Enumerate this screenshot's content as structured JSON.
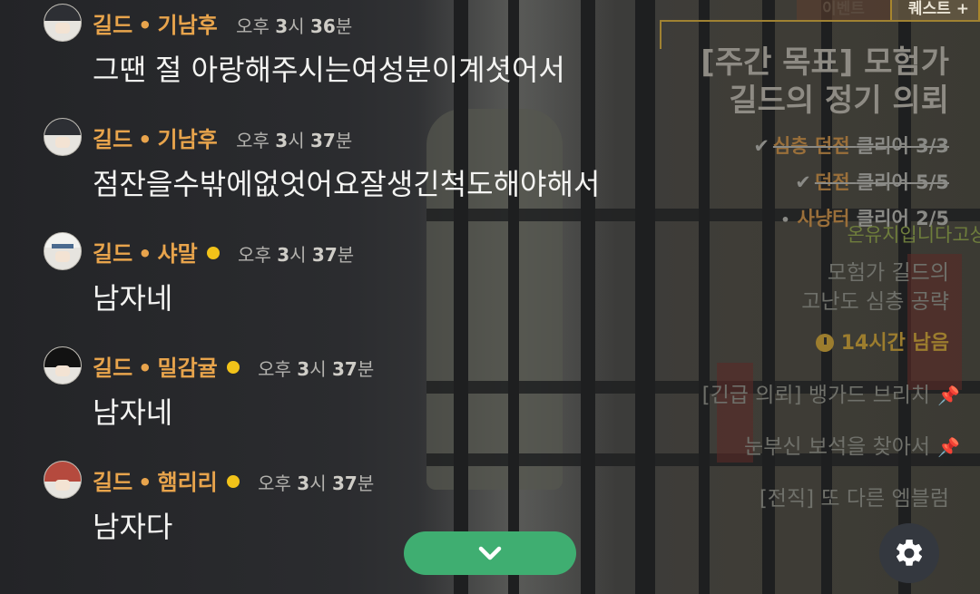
{
  "tabs": [
    {
      "label": "이벤트"
    },
    {
      "label": "퀘스트 +"
    }
  ],
  "quest_panel": {
    "title_line1": "[주간 목표] 모험가",
    "title_line2": "길드의 정기 의뢰",
    "objectives": [
      {
        "check": "✔",
        "name": "심층 던전",
        "text": "클리어 3/3"
      },
      {
        "check": "✔",
        "name": "던전",
        "text": "클리어 5/5"
      },
      {
        "bullet": "•",
        "name": "사냥터",
        "text": "클리어 2/5"
      }
    ],
    "overlap_text": "온유지입니다고상",
    "guild_quest_line1": "모험가 길드의",
    "guild_quest_line2": "고난도 심층 공략",
    "timer": "14시간 남음",
    "quests": [
      {
        "label": "[긴급 의뢰] 뱅가드 브리치"
      },
      {
        "label": "눈부신 보석을 찾아서"
      },
      {
        "label": "[전직] 또 다른 엠블럼"
      }
    ]
  },
  "chat": {
    "messages": [
      {
        "prefix": "길드",
        "separator": "•",
        "user": "기남후",
        "time_prefix": "오후",
        "hour": "3",
        "hour_unit": "시",
        "minute": "36",
        "minute_unit": "분",
        "text": "그땐 절 아랑해주시는여성분이계셧어서"
      },
      {
        "prefix": "길드",
        "separator": "•",
        "user": "기남후",
        "time_prefix": "오후",
        "hour": "3",
        "hour_unit": "시",
        "minute": "37",
        "minute_unit": "분",
        "text": "점잔을수밖에없엇어요잘생긴척도해야해서"
      },
      {
        "prefix": "길드",
        "separator": "•",
        "user": "샤말",
        "time_prefix": "오후",
        "hour": "3",
        "hour_unit": "시",
        "minute": "37",
        "minute_unit": "분",
        "text": "남자네"
      },
      {
        "prefix": "길드",
        "separator": "•",
        "user": "밀감귤",
        "time_prefix": "오후",
        "hour": "3",
        "hour_unit": "시",
        "minute": "37",
        "minute_unit": "분",
        "text": "남자네"
      },
      {
        "prefix": "길드",
        "separator": "•",
        "user": "햄리리",
        "time_prefix": "오후",
        "hour": "3",
        "hour_unit": "시",
        "minute": "37",
        "minute_unit": "분",
        "text": "남자다"
      }
    ]
  },
  "controls": {
    "scroll_icon": "chevron-down-icon",
    "settings_icon": "gear-icon"
  },
  "colors": {
    "guild_name": "#e8a44c",
    "online_dot": "#f2c319",
    "scroll_button": "#3fae71",
    "settings_button": "#34383f",
    "quest_highlight": "#9a6f3a"
  }
}
